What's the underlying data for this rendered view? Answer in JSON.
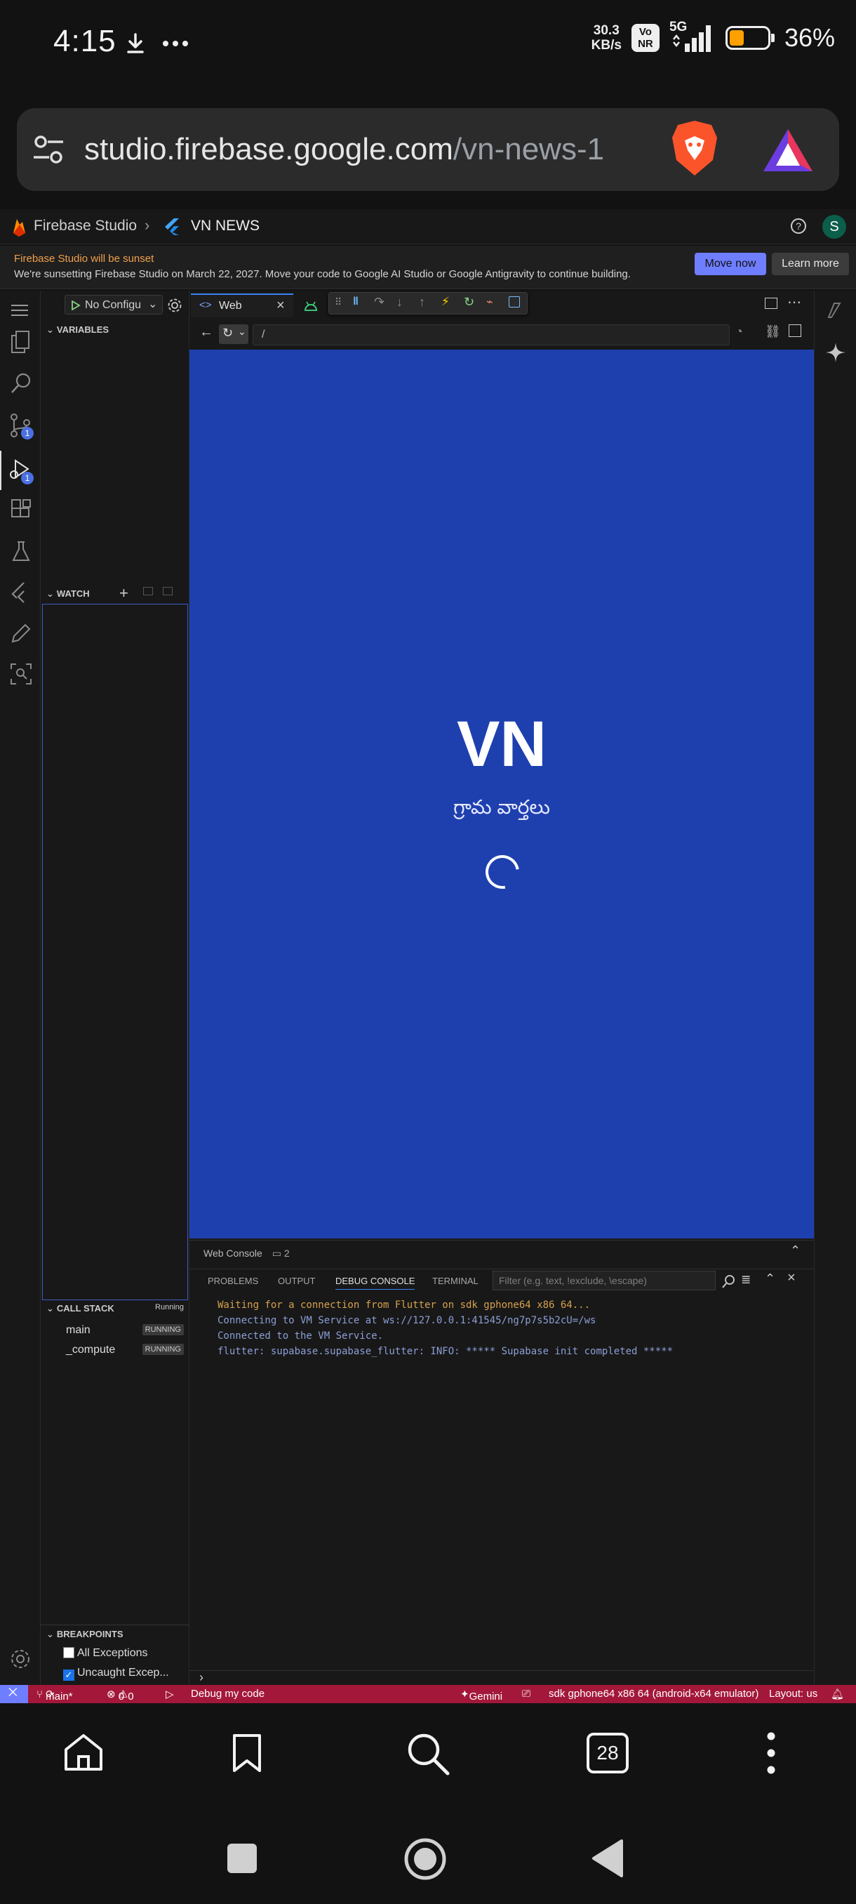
{
  "status_bar": {
    "time": "4:15",
    "speed_value": "30.3",
    "speed_unit": "KB/s",
    "volte": "Vo NR",
    "network": "5G",
    "battery": "36%"
  },
  "browser": {
    "url_main": "studio.firebase.google.com",
    "url_rest": "/vn-news-1"
  },
  "firebase_header": {
    "brand": "Firebase Studio",
    "project": "VN NEWS",
    "avatar": "S"
  },
  "banner": {
    "title": "Firebase Studio will be sunset",
    "text": "We're sunsetting Firebase Studio on March 22, 2027. Move your code to Google AI Studio or Google Antigravity to continue building.",
    "move_now": "Move now",
    "learn_more": "Learn more"
  },
  "run_config": {
    "label": "No Configu"
  },
  "sidebar": {
    "variables": "VARIABLES",
    "watch": "WATCH",
    "call_stack": "CALL STACK",
    "call_stack_status": "Running",
    "threads": [
      {
        "name": "main",
        "state": "RUNNING"
      },
      {
        "name": "_compute",
        "state": "RUNNING"
      }
    ],
    "breakpoints": "BREAKPOINTS",
    "bp_items": [
      {
        "label": "All Exceptions",
        "checked": false
      },
      {
        "label": "Uncaught Excep...",
        "checked": true
      }
    ]
  },
  "badges": {
    "scm": "1",
    "debug": "1"
  },
  "editor": {
    "tab_web": "Web",
    "path": "/"
  },
  "preview": {
    "logo": "VN",
    "subtitle": "గ్రామ వార్తలు"
  },
  "panel": {
    "title": "Web Console",
    "comment_count": "2",
    "tabs": [
      "PROBLEMS",
      "OUTPUT",
      "DEBUG CONSOLE",
      "TERMINAL"
    ],
    "filter_placeholder": "Filter (e.g. text, !exclude, \\escape)",
    "lines": [
      {
        "text": "Waiting for a connection from Flutter on sdk gphone64 x86 64...",
        "color": "#d7a14d"
      },
      {
        "text": "Connecting to VM Service at ws://127.0.0.1:41545/ng7p7s5b2cU=/ws",
        "color": "#8c9fd6"
      },
      {
        "text": "Connected to the VM Service.",
        "color": "#8c9fd6"
      },
      {
        "text": "flutter: supabase.supabase_flutter: INFO: ***** Supabase init completed *****",
        "color": "#8c9fd6"
      }
    ]
  },
  "statusline": {
    "branch": "main*",
    "errors": "0",
    "warnings": "0",
    "debug": "Debug my code",
    "gemini": "Gemini",
    "device": "sdk gphone64 x86 64 (android-x64 emulator)",
    "layout": "Layout: us"
  },
  "bottom_nav": {
    "tab_count": "28"
  },
  "colors": {
    "accent": "#6f7eff",
    "preview_bg": "#1e40af",
    "status_red": "#a3183a",
    "banner_title": "#f0a04b"
  }
}
